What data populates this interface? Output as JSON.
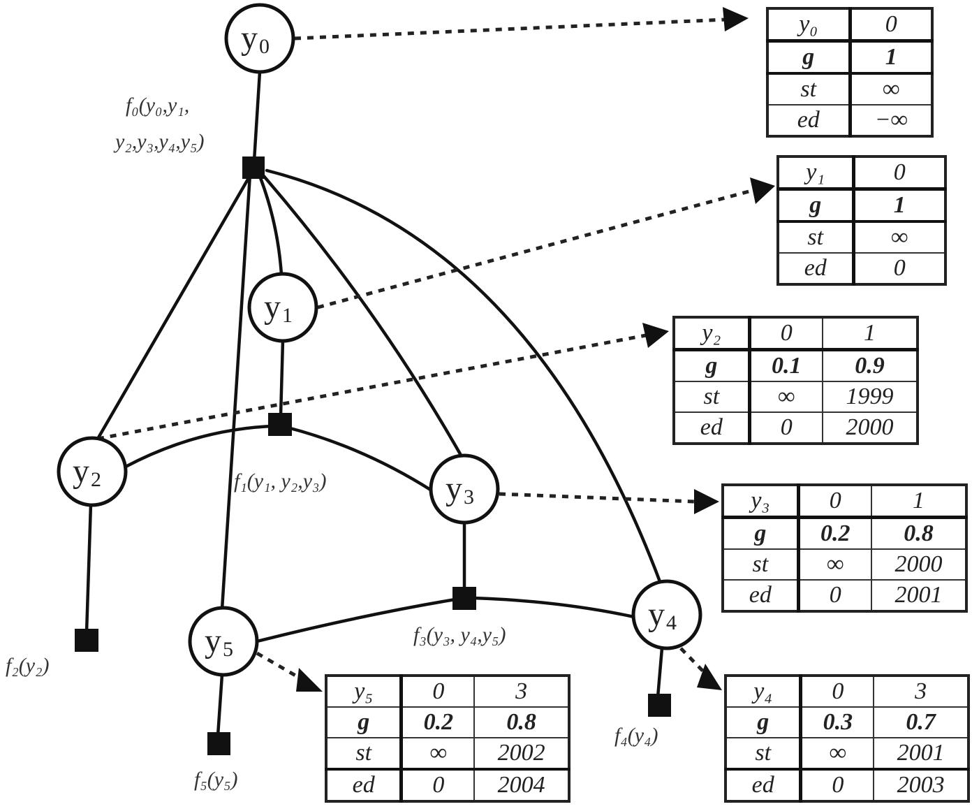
{
  "diagram": {
    "type": "factor-graph",
    "variables": [
      {
        "id": "y0",
        "label": "y",
        "sub": "0"
      },
      {
        "id": "y1",
        "label": "y",
        "sub": "1"
      },
      {
        "id": "y2",
        "label": "y",
        "sub": "2"
      },
      {
        "id": "y3",
        "label": "y",
        "sub": "3"
      },
      {
        "id": "y4",
        "label": "y",
        "sub": "4"
      },
      {
        "id": "y5",
        "label": "y",
        "sub": "5"
      }
    ],
    "factors": [
      {
        "id": "f0",
        "label_line1": "f₀(y₀,y₁,",
        "label_line2": "y₂,y₃,y₄,y₅)",
        "connects": [
          "y0",
          "y1",
          "y2",
          "y3",
          "y4",
          "y5"
        ]
      },
      {
        "id": "f1",
        "label": "f₁(y₁, y₂,y₃)",
        "connects": [
          "y1",
          "y2",
          "y3"
        ]
      },
      {
        "id": "f2",
        "label": "f₂(y₂)",
        "connects": [
          "y2"
        ]
      },
      {
        "id": "f3",
        "label": "f₃(y₃, y₄,y₅)",
        "connects": [
          "y3",
          "y4",
          "y5"
        ]
      },
      {
        "id": "f4",
        "label": "f₄(y₄)",
        "connects": [
          "y4"
        ]
      },
      {
        "id": "f5",
        "label": "f₅(y₅)",
        "connects": [
          "y5"
        ]
      }
    ],
    "tables": [
      {
        "id": "t0",
        "for": "y0",
        "header": [
          "y₀",
          "0"
        ],
        "rows": [
          {
            "name": "g",
            "values": [
              "1"
            ]
          },
          {
            "name": "st",
            "values": [
              "∞"
            ]
          },
          {
            "name": "ed",
            "values": [
              "−∞"
            ]
          }
        ]
      },
      {
        "id": "t1",
        "for": "y1",
        "header": [
          "y₁",
          "0"
        ],
        "rows": [
          {
            "name": "g",
            "values": [
              "1"
            ]
          },
          {
            "name": "st",
            "values": [
              "∞"
            ]
          },
          {
            "name": "ed",
            "values": [
              "0"
            ]
          }
        ]
      },
      {
        "id": "t2",
        "for": "y2",
        "header": [
          "y₂",
          "0",
          "1"
        ],
        "rows": [
          {
            "name": "g",
            "values": [
              "0.1",
              "0.9"
            ]
          },
          {
            "name": "st",
            "values": [
              "∞",
              "1999"
            ]
          },
          {
            "name": "ed",
            "values": [
              "0",
              "2000"
            ]
          }
        ]
      },
      {
        "id": "t3",
        "for": "y3",
        "header": [
          "y₃",
          "0",
          "1"
        ],
        "rows": [
          {
            "name": "g",
            "values": [
              "0.2",
              "0.8"
            ]
          },
          {
            "name": "st",
            "values": [
              "∞",
              "2000"
            ]
          },
          {
            "name": "ed",
            "values": [
              "0",
              "2001"
            ]
          }
        ]
      },
      {
        "id": "t5",
        "for": "y5",
        "header": [
          "y₅",
          "0",
          "3"
        ],
        "rows": [
          {
            "name": "g",
            "values": [
              "0.2",
              "0.8"
            ]
          },
          {
            "name": "st",
            "values": [
              "∞",
              "2002"
            ]
          },
          {
            "name": "ed",
            "values": [
              "0",
              "2004"
            ]
          }
        ]
      },
      {
        "id": "t4",
        "for": "y4",
        "header": [
          "y₄",
          "0",
          "3"
        ],
        "rows": [
          {
            "name": "g",
            "values": [
              "0.3",
              "0.7"
            ]
          },
          {
            "name": "st",
            "values": [
              "∞",
              "2001"
            ]
          },
          {
            "name": "ed",
            "values": [
              "0",
              "2003"
            ]
          }
        ]
      }
    ]
  }
}
